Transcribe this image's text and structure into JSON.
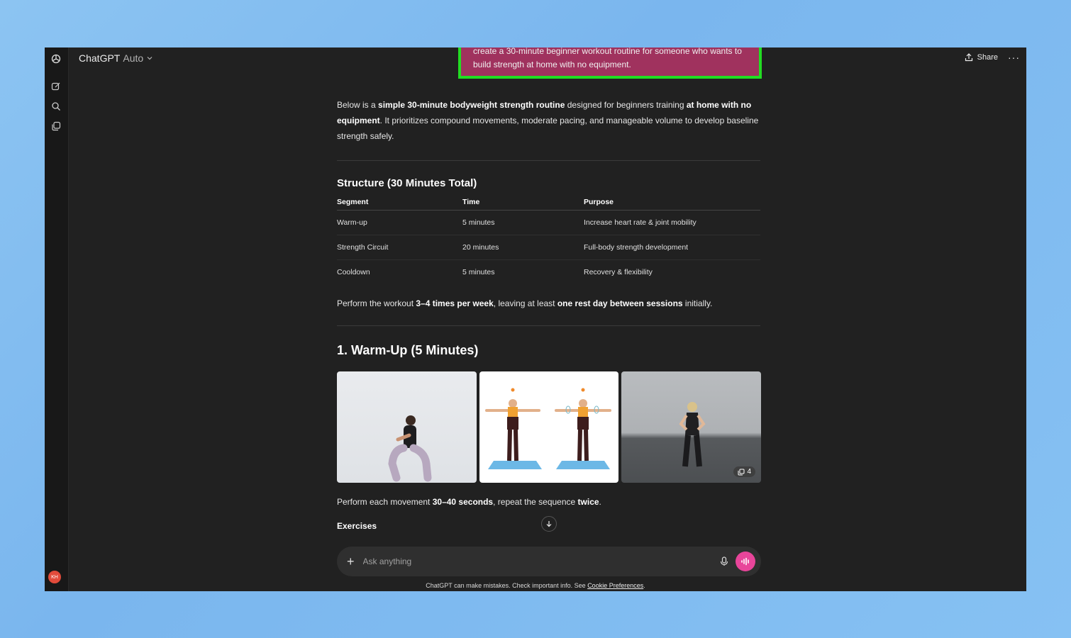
{
  "app": {
    "title": "ChatGPT",
    "model": "Auto",
    "share_label": "Share",
    "avatar_initials": "KH"
  },
  "user_message": "create a 30-minute beginner workout routine for someone who wants to build strength at home with no equipment.",
  "response": {
    "intro": {
      "p1": "Below is a ",
      "b1": "simple 30-minute bodyweight strength routine",
      "p2": " designed for beginners training ",
      "b2": "at home with no equipment",
      "p3": ". It prioritizes compound movements, moderate pacing, and manageable volume to develop baseline strength safely."
    },
    "structure_heading": "Structure (30 Minutes Total)",
    "table": {
      "headers": [
        "Segment",
        "Time",
        "Purpose"
      ],
      "rows": [
        [
          "Warm-up",
          "5 minutes",
          "Increase heart rate & joint mobility"
        ],
        [
          "Strength Circuit",
          "20 minutes",
          "Full-body strength development"
        ],
        [
          "Cooldown",
          "5 minutes",
          "Recovery & flexibility"
        ]
      ]
    },
    "frequency": {
      "p1": "Perform the workout ",
      "b1": "3–4 times per week",
      "p2": ", leaving at least ",
      "b2": "one rest day between sessions",
      "p3": " initially."
    },
    "warmup_heading": "1. Warm-Up (5 Minutes)",
    "image_count": "4",
    "instruction": {
      "p1": "Perform each movement ",
      "b1": "30–40 seconds",
      "p2": ", repeat the sequence ",
      "b2": "twice",
      "p3": "."
    },
    "exercises_heading": "Exercises"
  },
  "composer": {
    "placeholder": "Ask anything"
  },
  "footer": {
    "text": "ChatGPT can make mistakes. Check important info. See ",
    "link": "Cookie Preferences",
    "end": "."
  },
  "colors": {
    "user_bubble": "#a0325e",
    "highlight_border": "#22dd22",
    "voice_button": "#e8459a"
  }
}
